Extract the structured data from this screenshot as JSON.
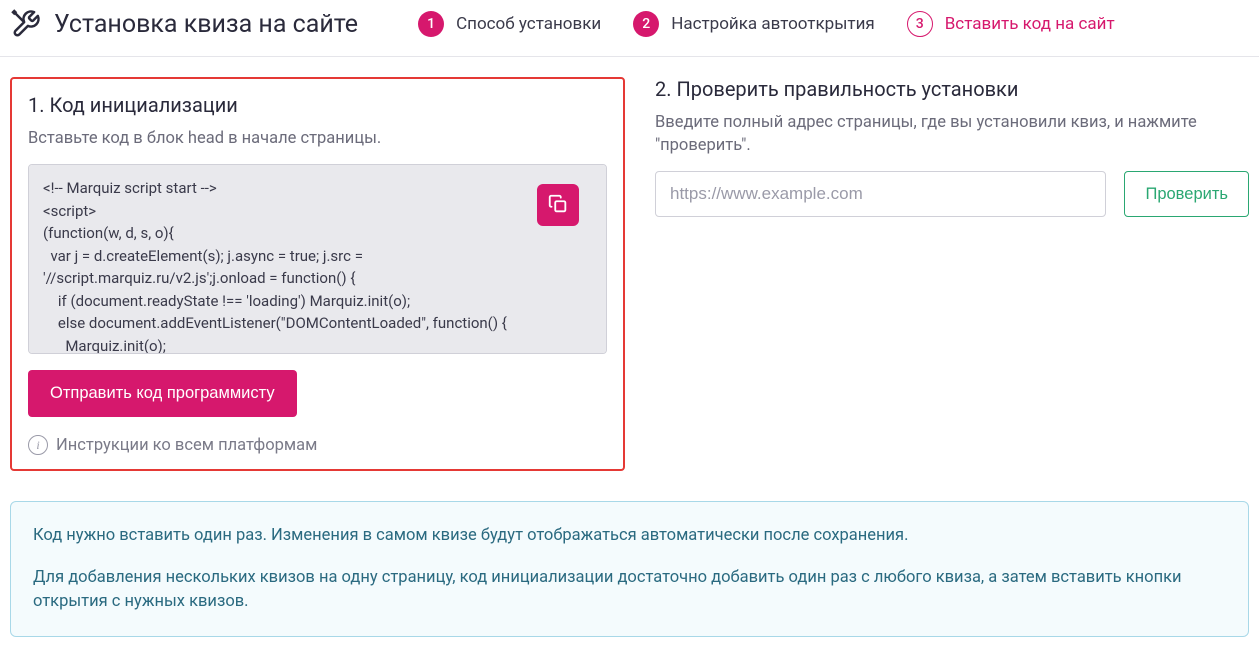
{
  "header": {
    "title": "Установка квиза на сайте",
    "steps": [
      {
        "num": "1",
        "label": "Способ установки",
        "state": "done"
      },
      {
        "num": "2",
        "label": "Настройка автооткрытия",
        "state": "done"
      },
      {
        "num": "3",
        "label": "Вставить код на сайт",
        "state": "active"
      }
    ]
  },
  "left": {
    "title": "1. Код инициализации",
    "desc": "Вставьте код в блок head в начале страницы.",
    "code": "<!-- Marquiz script start -->\n<script>\n(function(w, d, s, o){\n  var j = d.createElement(s); j.async = true; j.src =\n'//script.marquiz.ru/v2.js';j.onload = function() {\n    if (document.readyState !== 'loading') Marquiz.init(o);\n    else document.addEventListener(\"DOMContentLoaded\", function() {\n      Marquiz.init(o);",
    "send_label": "Отправить код программисту",
    "instructions_label": "Инструкции ко всем платформам"
  },
  "right": {
    "title": "2. Проверить правильность установки",
    "desc": "Введите полный адрес страницы, где вы установили квиз, и нажмите \"проверить\".",
    "url_placeholder": "https://www.example.com",
    "check_label": "Проверить"
  },
  "note": {
    "p1": "Код нужно вставить один раз. Изменения в самом квизе будут отображаться автоматически после сохранения.",
    "p2": "Для добавления нескольких квизов на одну страницу, код инициализации достаточно добавить один раз с любого квиза, а затем вставить кнопки открытия с нужных квизов."
  },
  "colors": {
    "accent": "#d6186d",
    "green": "#2aa772",
    "alert_border": "#e53935",
    "info_border": "#a8d8e8"
  }
}
